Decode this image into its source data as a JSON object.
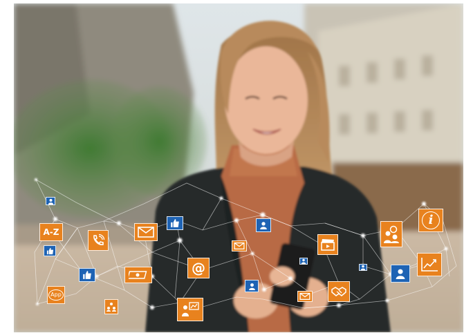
{
  "scene": {
    "subject": "woman-with-smartphone",
    "overlay": "social-network-icons"
  },
  "icons": {
    "az_text": "A-Z",
    "app_text": "App",
    "at_text": "@",
    "info_text": "i"
  },
  "colors": {
    "icon_orange": "#e8821e",
    "icon_blue": "#1e63b4",
    "network_line": "#ffffff"
  }
}
